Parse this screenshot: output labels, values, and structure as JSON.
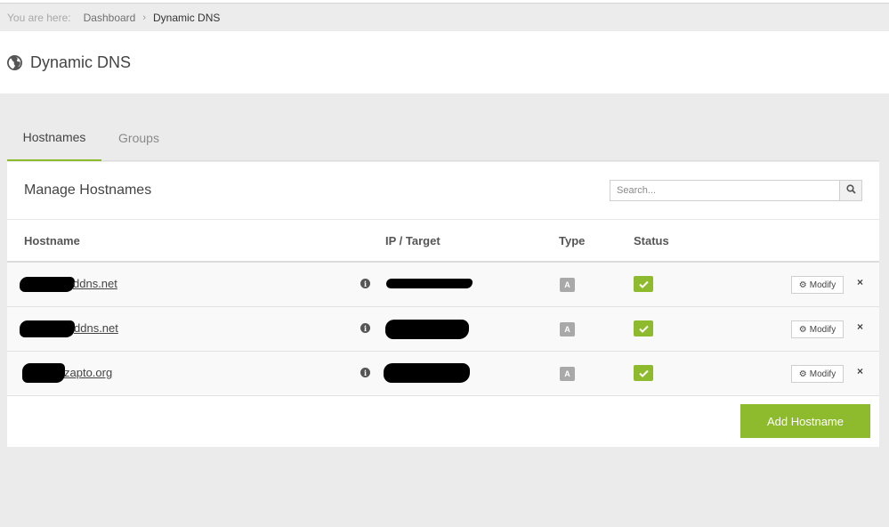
{
  "breadcrumb": {
    "prefix": "You are here:",
    "items": [
      "Dashboard",
      "Dynamic DNS"
    ],
    "separator": "›"
  },
  "header": {
    "title": "Dynamic DNS",
    "icon": "globe-icon"
  },
  "tabs": [
    {
      "label": "Hostnames",
      "active": true
    },
    {
      "label": "Groups",
      "active": false
    }
  ],
  "panel": {
    "title": "Manage Hostnames",
    "search": {
      "placeholder": "Search...",
      "value": ""
    }
  },
  "table": {
    "columns": [
      "Hostname",
      "IP / Target",
      "Type",
      "Status"
    ],
    "rows": [
      {
        "hostname": "ddns.net",
        "type": "A",
        "modify": "Modify",
        "delete": "×"
      },
      {
        "hostname": "ddns.net",
        "type": "A",
        "modify": "Modify",
        "delete": "×"
      },
      {
        "hostname": "zapto.org",
        "type": "A",
        "modify": "Modify",
        "delete": "×"
      }
    ]
  },
  "actions": {
    "add_label": "Add Hostname"
  },
  "colors": {
    "accent": "#8dbb2d",
    "type_badge": "#a9a9a9"
  }
}
